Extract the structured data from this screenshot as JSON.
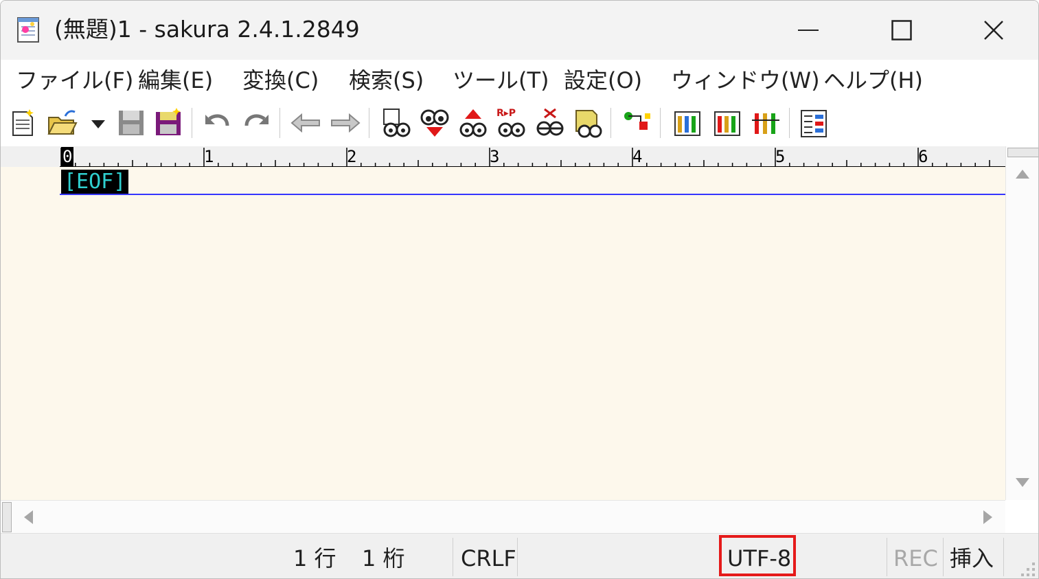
{
  "window": {
    "title": "(無題)1 - sakura 2.4.1.2849"
  },
  "menu": {
    "items": [
      {
        "label": "ファイル(F)"
      },
      {
        "label": "編集(E)"
      },
      {
        "label": "変換(C)"
      },
      {
        "label": "検索(S)"
      },
      {
        "label": "ツール(T)"
      },
      {
        "label": "設定(O)"
      },
      {
        "label": "ウィンドウ(W)"
      },
      {
        "label": "ヘルプ(H)"
      }
    ]
  },
  "toolbar": {
    "buttons": [
      {
        "icon": "new-file-icon"
      },
      {
        "icon": "open-file-icon"
      },
      {
        "icon": "dropdown-arrow-icon"
      },
      {
        "icon": "save-icon"
      },
      {
        "icon": "save-as-icon"
      },
      {
        "icon": "undo-icon"
      },
      {
        "icon": "redo-icon"
      },
      {
        "icon": "jump-back-icon"
      },
      {
        "icon": "jump-forward-icon"
      },
      {
        "icon": "find-icon"
      },
      {
        "icon": "find-next-icon"
      },
      {
        "icon": "find-prev-icon"
      },
      {
        "icon": "replace-icon"
      },
      {
        "icon": "clear-mark-icon"
      },
      {
        "icon": "grep-icon"
      },
      {
        "icon": "outline-icon"
      },
      {
        "icon": "common-settings-icon"
      },
      {
        "icon": "type-settings-icon"
      },
      {
        "icon": "font-settings-icon"
      },
      {
        "icon": "window-list-icon"
      }
    ]
  },
  "ruler": {
    "labels": [
      "0",
      "1",
      "2",
      "3",
      "4",
      "5",
      "6"
    ]
  },
  "editor": {
    "eof_marker": "[EOF]"
  },
  "status": {
    "line": "1 行",
    "column": "1 桁",
    "newline": "CRLF",
    "encoding": "UTF-8",
    "rec": "REC",
    "insert_mode": "挿入"
  },
  "colors": {
    "editor_bg": "#fdf8ec",
    "eof_fg": "#2fd0d0",
    "cursor_line": "#3535ff",
    "highlight": "#e51a1a"
  }
}
